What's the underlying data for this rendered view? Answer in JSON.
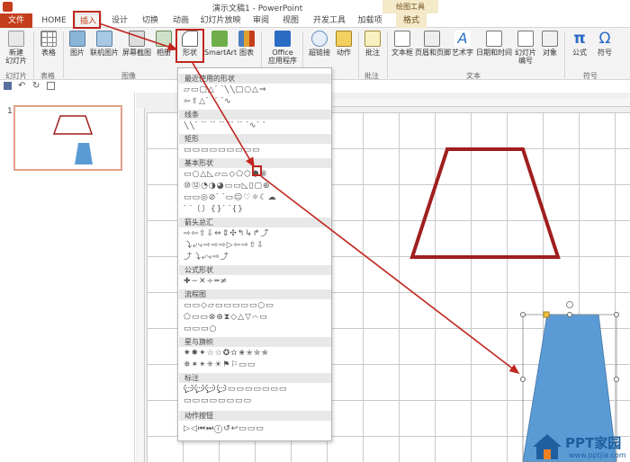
{
  "window": {
    "title": "演示文稿1 - PowerPoint",
    "context_label": "绘图工具"
  },
  "tabs": [
    "文件",
    "HOME",
    "插入",
    "设计",
    "切换",
    "动画",
    "幻灯片放映",
    "审阅",
    "视图",
    "开发工具",
    "加载项",
    "格式"
  ],
  "ribbon": {
    "buttons": [
      {
        "label": "新建\n幻灯片",
        "icon": "new-slide-icon"
      },
      {
        "label": "表格",
        "icon": "table-icon"
      },
      {
        "label": "图片",
        "icon": "picture-icon"
      },
      {
        "label": "联机图片",
        "icon": "online-picture-icon"
      },
      {
        "label": "屏幕截图",
        "icon": "screenshot-icon"
      },
      {
        "label": "相册",
        "icon": "album-icon"
      },
      {
        "label": "形状",
        "icon": "shapes-icon"
      },
      {
        "label": "SmartArt",
        "icon": "smartart-icon"
      },
      {
        "label": "图表",
        "icon": "chart-icon"
      },
      {
        "label": "Office\n应用程序",
        "icon": "office-apps-icon"
      },
      {
        "label": "超链接",
        "icon": "hyperlink-icon"
      },
      {
        "label": "动作",
        "icon": "action-icon"
      },
      {
        "label": "批注",
        "icon": "comment-icon"
      },
      {
        "label": "文本框",
        "icon": "textbox-icon"
      },
      {
        "label": "页眉和页脚",
        "icon": "header-footer-icon"
      },
      {
        "label": "艺术字",
        "icon": "wordart-icon"
      },
      {
        "label": "日期和时间",
        "icon": "datetime-icon"
      },
      {
        "label": "幻灯片\n编号",
        "icon": "slide-number-icon"
      },
      {
        "label": "对象",
        "icon": "object-icon"
      },
      {
        "label": "公式",
        "icon": "equation-icon"
      },
      {
        "label": "符号",
        "icon": "symbol-icon"
      }
    ],
    "groups": [
      "幻灯片",
      "表格",
      "图像",
      "批注",
      "文本",
      "符号"
    ]
  },
  "thumbnail": {
    "number": "1"
  },
  "shapes_menu": {
    "sections": [
      "最近使用的形状",
      "线条",
      "矩形",
      "基本形状",
      "箭头总汇",
      "公式形状",
      "流程图",
      "星与旗帜",
      "标注",
      "动作按钮"
    ],
    "rows": [
      "▱▭▢△⌒╲╲□○△⇒",
      "⇦⇧△⌒⌒∿",
      "╲╲⌒⌒⌒⌒⌒⌒∿⌒",
      "▭▭▭▭▭▭▭▭▭",
      "▭○△◺▱⏢◇⬠⬡⬢⑧",
      "⑩⑫◔◑◕▭▭◺▯▢⊕",
      "▭▭◎⊘⌒▭☺♡☼☾☁",
      "⌒〔〕{}⌒{}",
      "⇨⇦⇧⇩⇔⇕✣↰↳↱⤴",
      "⤵⤶⤷⇨⇨⇨▷⇦⇨⇧⇩",
      "⤴⤵⤶⤷⇨⤴",
      "✚−✕÷═≠",
      "▭▭◇▱▭▭▭▭▭○▭",
      "⬠▭▭⊗⊕⧗◇△▽⌒▭",
      "▭▭▭○",
      "✷✸✦☆☆✪✫✬✭✮✯",
      "✵✶✴✳☀⚑⚐▭▭",
      "💬💬💬💬▭▭▭▭▭▭▭",
      "▭▭▭▭▭▭▭▭",
      "▷◁⏮⏭ⓘ↺↩▭▭▭"
    ]
  },
  "watermark": {
    "brand": "PPT家园",
    "url": "www.pptjia.com"
  },
  "colors": {
    "accent": "#c43e1c",
    "shape_fill": "#5b9bd5",
    "outline": "#a01e1e"
  }
}
